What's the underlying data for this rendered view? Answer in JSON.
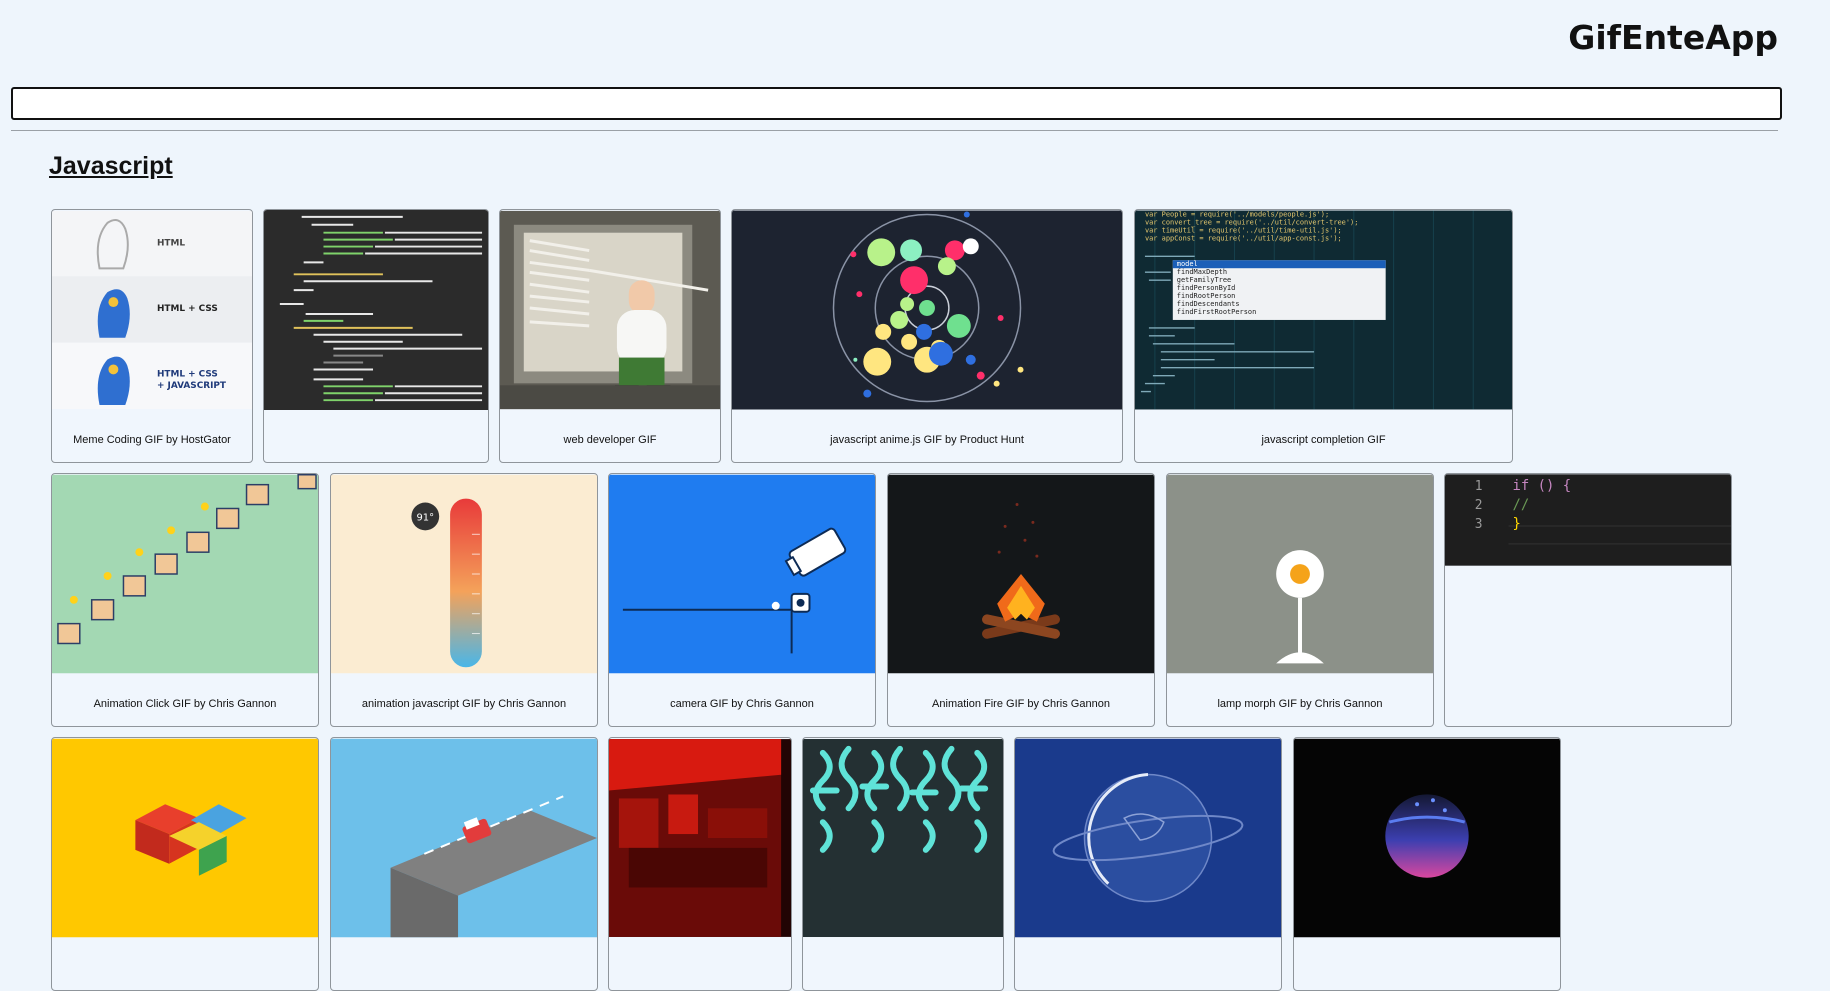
{
  "app": {
    "title": "GifEnteApp"
  },
  "search": {
    "value": "",
    "placeholder": ""
  },
  "category": {
    "title": "Javascript"
  },
  "gifs": [
    {
      "caption": "Meme Coding GIF by HostGator",
      "thumb_text": [
        "HTML",
        "HTML + CSS",
        "HTML + CSS",
        "+ JAVASCRIPT"
      ]
    },
    {
      "caption": ""
    },
    {
      "caption": "web developer GIF"
    },
    {
      "caption": "javascript anime.js GIF by Product Hunt"
    },
    {
      "caption": "javascript completion GIF",
      "code": [
        "var People = require('../models/people.js');",
        "var convert_tree = require('../util/convert-tree');",
        "var timeUtil = require('../util/time-util.js');",
        "var appConst = require('../util/app-const.js');"
      ],
      "menu": [
        "model",
        "findMaxDepth",
        "getFamilyTree",
        "findPersonById",
        "findRootPerson",
        "findDescendants",
        "findFirstRootPerson"
      ]
    },
    {
      "caption": "Animation Click GIF by Chris Gannon"
    },
    {
      "caption": "animation javascript GIF by Chris Gannon",
      "temp": "91°"
    },
    {
      "caption": "camera GIF by Chris Gannon"
    },
    {
      "caption": "Animation Fire GIF by Chris Gannon"
    },
    {
      "caption": "lamp morph GIF by Chris Gannon"
    },
    {
      "caption": "",
      "code_lines": [
        "1",
        "2",
        "3"
      ],
      "code": [
        "if () {",
        "  //",
        "}"
      ]
    },
    {
      "caption": ""
    },
    {
      "caption": ""
    },
    {
      "caption": ""
    },
    {
      "caption": ""
    },
    {
      "caption": ""
    },
    {
      "caption": ""
    }
  ]
}
